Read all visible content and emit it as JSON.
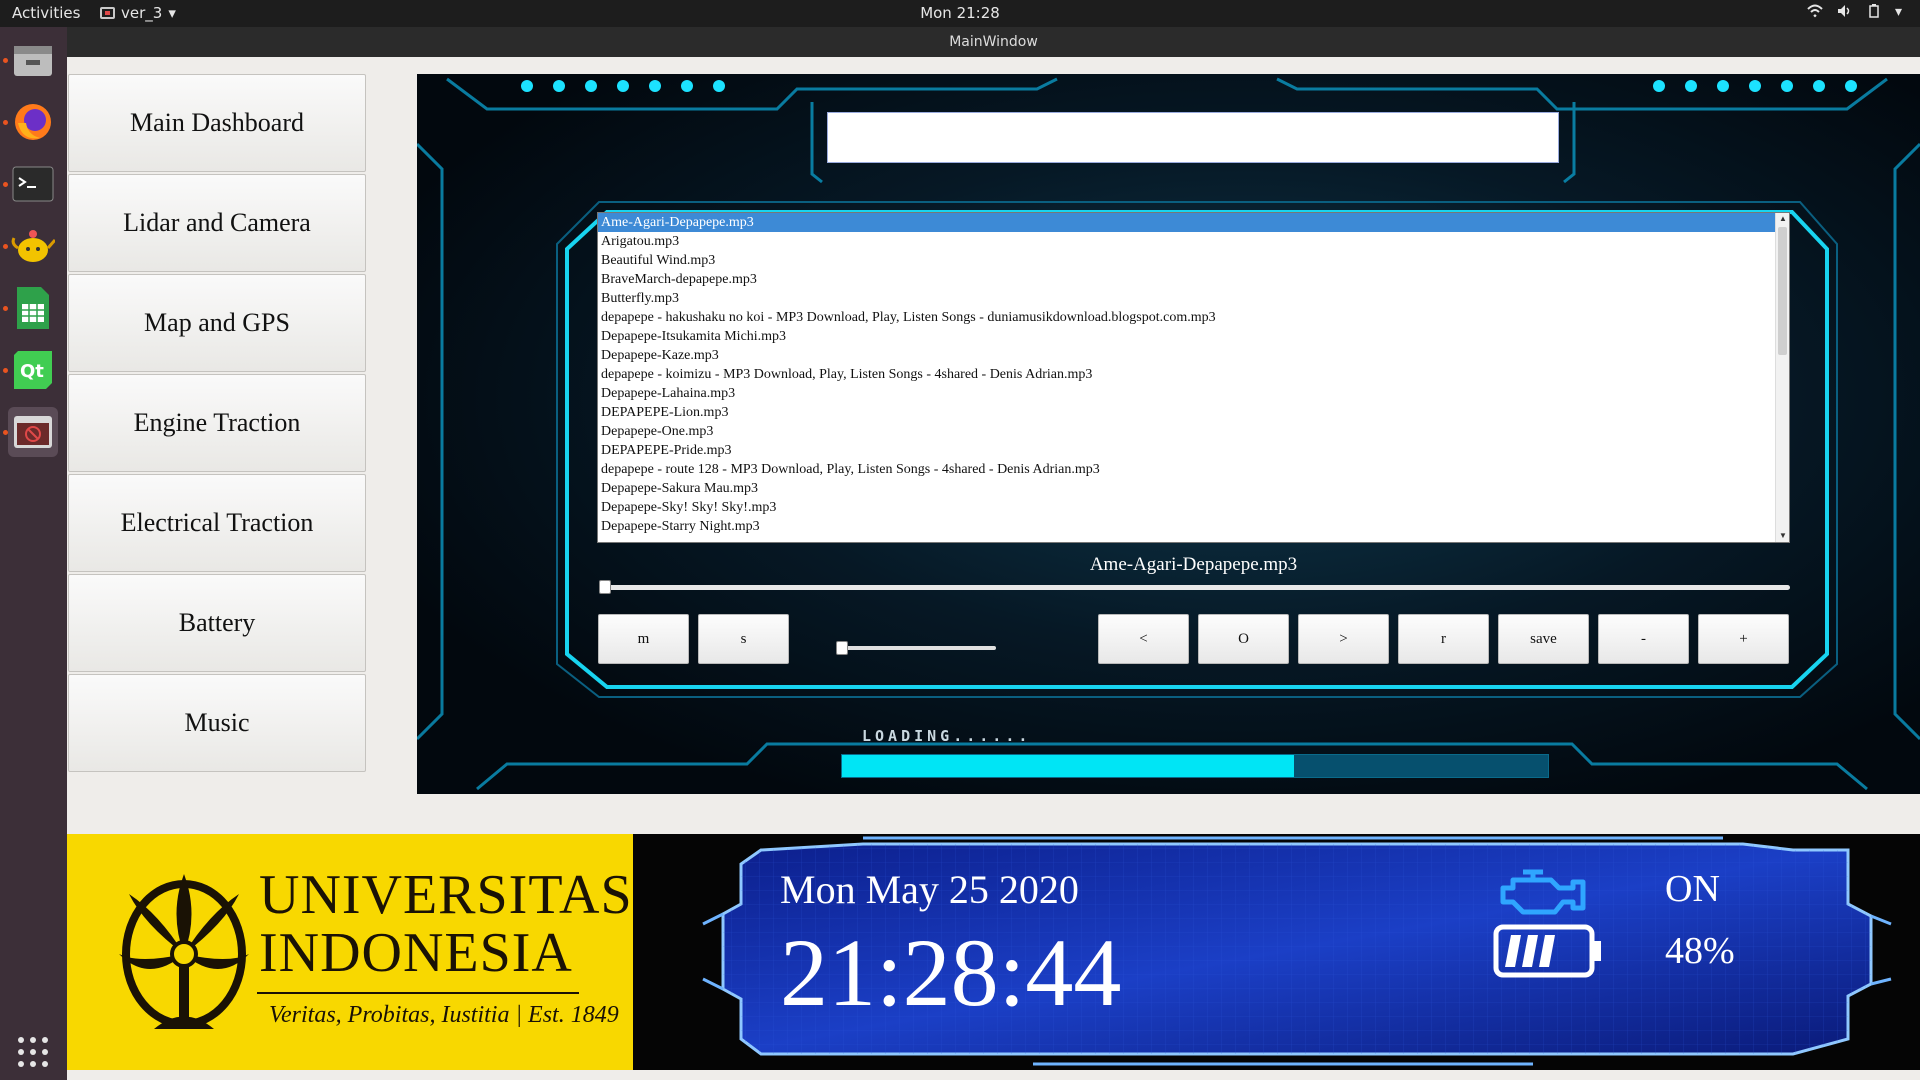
{
  "topbar": {
    "activities": "Activities",
    "app_name": "ver_3",
    "clock": "Mon 21:28"
  },
  "dock": {
    "items": [
      {
        "name": "files-icon"
      },
      {
        "name": "firefox-icon"
      },
      {
        "name": "terminal-icon"
      },
      {
        "name": "teapot-icon"
      },
      {
        "name": "spreadsheet-icon"
      },
      {
        "name": "qt-creator-icon"
      },
      {
        "name": "app-window-icon"
      }
    ]
  },
  "window": {
    "title": "MainWindow"
  },
  "nav": {
    "items": [
      {
        "label": "Main Dashboard"
      },
      {
        "label": "Lidar and Camera"
      },
      {
        "label": "Map and GPS"
      },
      {
        "label": "Engine Traction"
      },
      {
        "label": "Electrical Traction"
      },
      {
        "label": "Battery"
      },
      {
        "label": "Music"
      }
    ]
  },
  "music": {
    "title_field_value": "",
    "playlist": [
      "Ame-Agari-Depapepe.mp3",
      "Arigatou.mp3",
      "Beautiful Wind.mp3",
      "BraveMarch-depapepe.mp3",
      "Butterfly.mp3",
      "depapepe - hakushaku no koi - MP3 Download, Play, Listen Songs - duniamusikdownload.blogspot.com.mp3",
      "Depapepe-Itsukamita Michi.mp3",
      "Depapepe-Kaze.mp3",
      "depapepe - koimizu - MP3 Download, Play, Listen Songs - 4shared - Denis Adrian.mp3",
      "Depapepe-Lahaina.mp3",
      "DEPAPEPE-Lion.mp3",
      "Depapepe-One.mp3",
      "DEPAPEPE-Pride.mp3",
      "depapepe - route 128 - MP3 Download, Play, Listen Songs - 4shared - Denis Adrian.mp3",
      "Depapepe-Sakura Mau.mp3",
      "Depapepe-Sky! Sky! Sky!.mp3",
      "Depapepe-Starry Night.mp3"
    ],
    "selected_index": 0,
    "now_playing": "Ame-Agari-Depapepe.mp3",
    "seek_fraction": 0.0,
    "volume_fraction": 0.0,
    "buttons": {
      "mute": "m",
      "stop": "s",
      "prev": "<",
      "play": "O",
      "next": ">",
      "repeat": "r",
      "save": "save",
      "vol_down": "-",
      "vol_up": "+"
    },
    "loading_label": "LOADING......",
    "loading_fraction": 0.64
  },
  "university": {
    "name_line1": "UNIVERSITAS",
    "name_line2": "INDONESIA",
    "motto": "Veritas, Probitas, Iustitia  |  Est. 1849"
  },
  "dashboard": {
    "date": "Mon May 25 2020",
    "time": "21:28:44",
    "engine_status": "ON",
    "battery_percent": "48%",
    "battery_level_fraction": 0.48
  },
  "colors": {
    "accent_cyan": "#00e5f5",
    "selection_blue": "#3d8ad6",
    "ui_yellow": "#f8d800",
    "dash_blue": "#1a3fb0"
  }
}
